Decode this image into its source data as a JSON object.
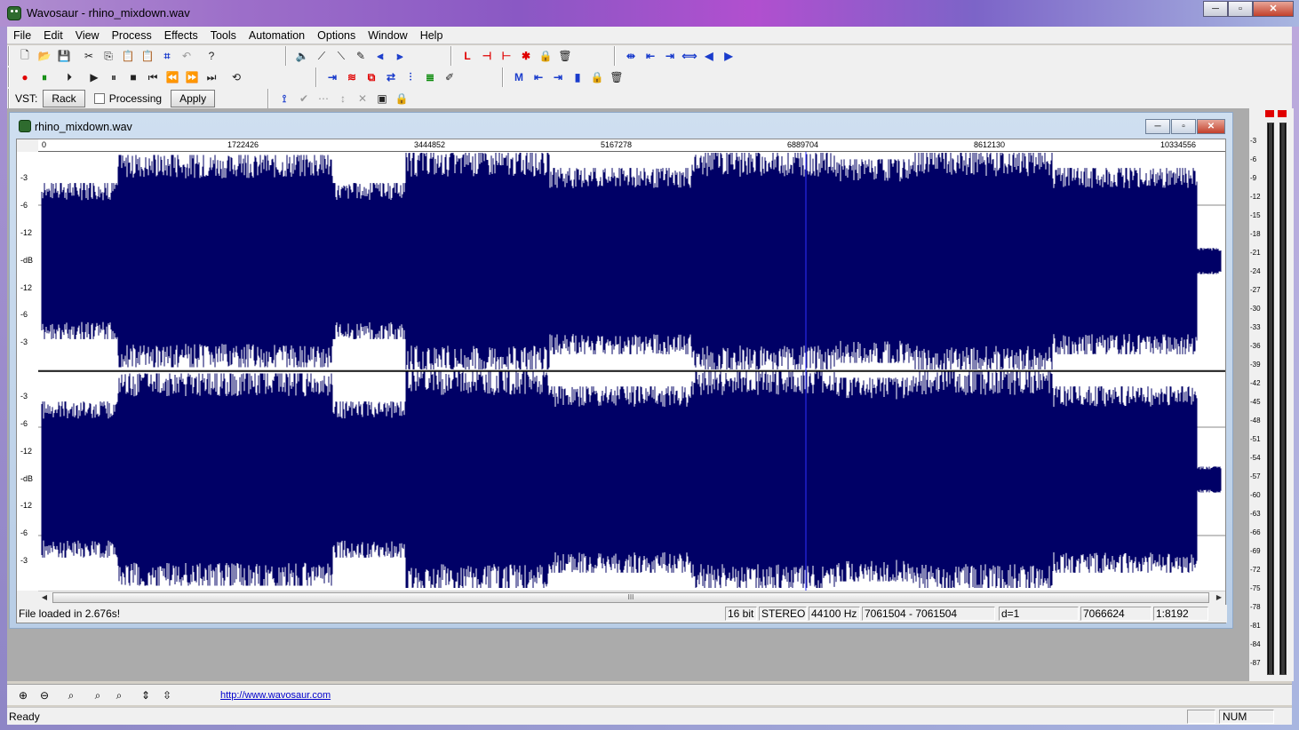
{
  "window": {
    "title": "Wavosaur - rhino_mixdown.wav",
    "buttons": [
      "─",
      "▫",
      "✕"
    ]
  },
  "menu": [
    "File",
    "Edit",
    "View",
    "Process",
    "Effects",
    "Tools",
    "Automation",
    "Options",
    "Window",
    "Help"
  ],
  "vst": {
    "label": "VST:",
    "rack_label": "Rack",
    "processing_label": "Processing",
    "apply_label": "Apply"
  },
  "document": {
    "title": "rhino_mixdown.wav",
    "ruler_ticks": [
      "0",
      "1722426",
      "3444852",
      "5167278",
      "6889704",
      "8612130",
      "10334556"
    ],
    "db_labels_top": [
      "-3",
      "-6",
      "-12",
      "-dB",
      "-12",
      "-6",
      "-3"
    ],
    "db_labels_bottom": [
      "-3",
      "-6",
      "-12",
      "-dB",
      "-12",
      "-6",
      "-3"
    ],
    "scroll_grip": "III",
    "status": {
      "message": "File loaded in 2.676s!",
      "bits": "16 bit",
      "channels": "STEREO",
      "rate": "44100 Hz",
      "selection": "7061504 - 7061504",
      "delta": "d=1",
      "position": "7066624",
      "zoom": "1:8192"
    },
    "wave_color": "#000066"
  },
  "meter": {
    "labels": [
      "-3",
      "-6",
      "-9",
      "-12",
      "-15",
      "-18",
      "-21",
      "-24",
      "-27",
      "-30",
      "-33",
      "-36",
      "-39",
      "-42",
      "-45",
      "-48",
      "-51",
      "-54",
      "-57",
      "-60",
      "-63",
      "-66",
      "-69",
      "-72",
      "-75",
      "-78",
      "-81",
      "-84",
      "-87"
    ],
    "clip_color": "#e00000"
  },
  "bottom": {
    "link": "http://www.wavosaur.com"
  },
  "app_status": {
    "message": "Ready",
    "num": "NUM"
  }
}
